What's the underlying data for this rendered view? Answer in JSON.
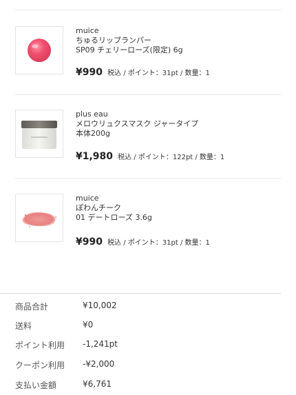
{
  "items": [
    {
      "brand": "muice",
      "name_line1": "ちゅるリップランパー",
      "name_line2": "SP09 チェリーローズ(限定) 6g",
      "price": "¥990",
      "meta": "税込 / ポイント：31pt / 数量：1",
      "image_icon": "cherry-lip-swatch-icon"
    },
    {
      "brand": "plus eau",
      "name_line1": "メロウリュクスマスク ジャータイプ",
      "name_line2": "本体200g",
      "price": "¥1,980",
      "meta": "税込 / ポイント：122pt / 数量：1",
      "image_icon": "jar-icon"
    },
    {
      "brand": "muice",
      "name_line1": "ぽわんチーク",
      "name_line2": "01 デートローズ 3.6g",
      "price": "¥990",
      "meta": "税込 / ポイント：31pt / 数量：1",
      "image_icon": "cheek-powder-swatch-icon"
    }
  ],
  "summary": [
    {
      "label": "商品合計",
      "value": "¥10,002"
    },
    {
      "label": "送料",
      "value": "¥0"
    },
    {
      "label": "ポイント利用",
      "value": "-1,241pt"
    },
    {
      "label": "クーポン利用",
      "value": "-¥2,000"
    },
    {
      "label": "支払い金額",
      "value": "¥6,761"
    }
  ],
  "colors": {
    "divider": "#e6e6e6",
    "text": "#333333",
    "lip_pink": "#f0506e",
    "cheek_pink": "#e88a88"
  }
}
